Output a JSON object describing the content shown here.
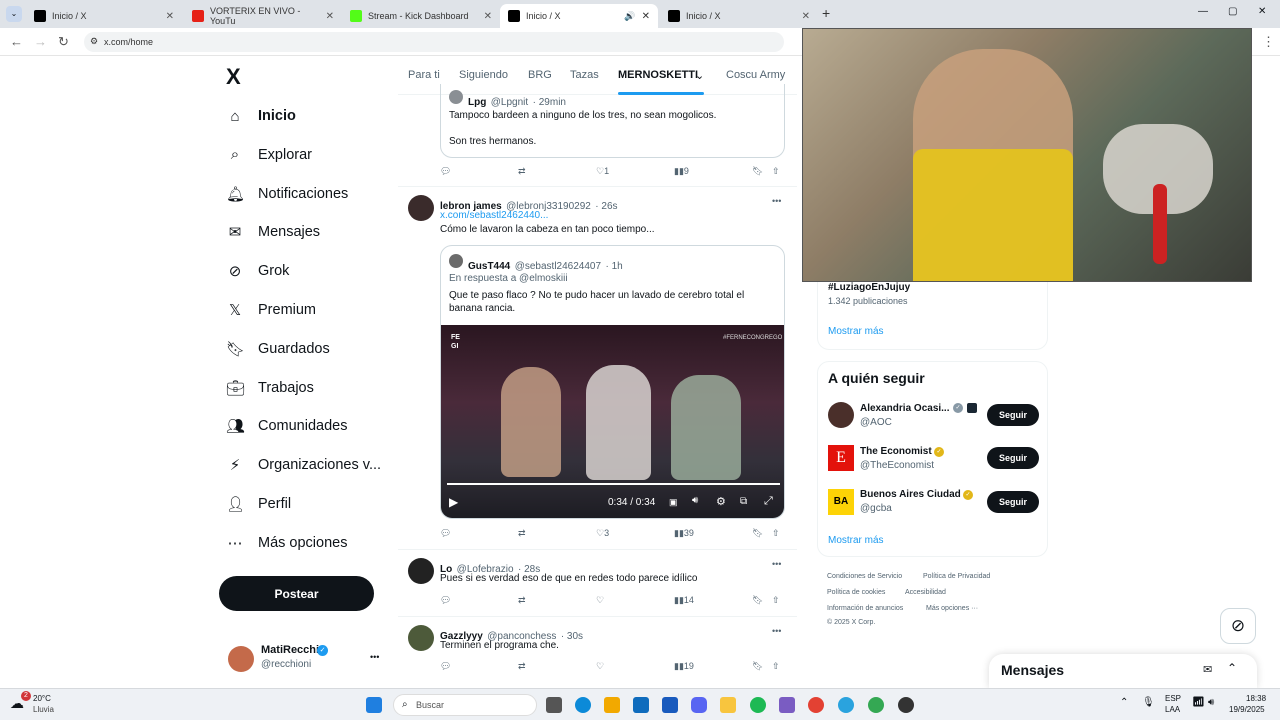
{
  "browser": {
    "tabs": [
      {
        "title": "Inicio / X"
      },
      {
        "title": "VORTERIX EN VIVO - YouTu"
      },
      {
        "title": "Stream - Kick Dashboard"
      },
      {
        "title": "Inicio / X"
      },
      {
        "title": "Inicio / X"
      }
    ],
    "new_tab": "+",
    "url": "x.com/home"
  },
  "sidebar": {
    "logo": "X",
    "items": [
      {
        "label": "Inicio",
        "icon": "home-icon"
      },
      {
        "label": "Explorar",
        "icon": "search-icon"
      },
      {
        "label": "Notificaciones",
        "icon": "bell-icon"
      },
      {
        "label": "Mensajes",
        "icon": "mail-icon"
      },
      {
        "label": "Grok",
        "icon": "grok-icon"
      },
      {
        "label": "Premium",
        "icon": "x-icon"
      },
      {
        "label": "Guardados",
        "icon": "bookmark-icon"
      },
      {
        "label": "Trabajos",
        "icon": "briefcase-icon"
      },
      {
        "label": "Comunidades",
        "icon": "people-icon"
      },
      {
        "label": "Organizaciones v...",
        "icon": "lightning-icon"
      },
      {
        "label": "Perfil",
        "icon": "person-icon"
      },
      {
        "label": "Más opciones",
        "icon": "more-circle-icon"
      }
    ],
    "post_button": "Postear",
    "account": {
      "name": "MatiRecchi",
      "handle": "@recchioni",
      "more": "•••"
    }
  },
  "topnav": {
    "tabs": [
      "Para ti",
      "Siguiendo",
      "BRG",
      "Tazas",
      "MERNOSKETTI",
      "Coscu Army"
    ],
    "selected": "MERNOSKETTI"
  },
  "feed": {
    "quote_top": {
      "name": "Lpg",
      "handle": "@Lpgnit",
      "time": "· 29min",
      "text1": "Tampoco bardeen a ninguno de los tres, no sean mogolicos.",
      "text2": "Son tres hermanos."
    },
    "actions1": {
      "likes": "1",
      "views": "9"
    },
    "post1": {
      "name": "lebron james",
      "handle": "@lebronj33190292",
      "time": "· 26s",
      "link": "x.com/sebastl2462440...",
      "text": "Cómo le lavaron la cabeza en tan poco tiempo...",
      "quote": {
        "name": "GusT444",
        "handle": "@sebastl24624407",
        "time": "· 1h",
        "reply_to": "En respuesta a @elmoskiii",
        "text": "Que te paso flaco ? No te pudo hacer un lavado de cerebro total el banana rancia.",
        "video_time": "0:34 / 0:34",
        "video_tag": "#FERNECONGREGO",
        "video_logo": "FE GI"
      }
    },
    "actions2": {
      "likes": "3",
      "views": "39"
    },
    "post2": {
      "name": "Lo",
      "handle": "@Lofebrazio",
      "time": "· 28s",
      "text": "Pues si es verdad eso de que en redes todo parece idílico"
    },
    "actions3": {
      "views": "14"
    },
    "post3": {
      "name": "Gazzlyyy",
      "handle": "@panconchess",
      "time": "· 30s",
      "text": "Terminen el programa che."
    },
    "actions4": {
      "views": "19"
    },
    "more_menu": "•••"
  },
  "right": {
    "trend": {
      "tag": "#LuziagoEnJujuy",
      "count": "1.342 publicaciones",
      "more": "Mostrar más"
    },
    "follow": {
      "title": "A quién seguir",
      "items": [
        {
          "name": "Alexandria Ocasi...",
          "handle": "@AOC",
          "button": "Seguir"
        },
        {
          "name": "The Economist",
          "handle": "@TheEconomist",
          "button": "Seguir"
        },
        {
          "name": "Buenos Aires Ciudad",
          "handle": "@gcba",
          "button": "Seguir"
        }
      ],
      "more": "Mostrar más"
    },
    "footer": {
      "l1a": "Condiciones de Servicio",
      "l1b": "Política de Privacidad",
      "l2a": "Política de cookies",
      "l2b": "Accesibilidad",
      "l3a": "Información de anuncios",
      "l3b": "Más opciones ···",
      "copy": "© 2025 X Corp."
    },
    "messages": "Mensajes"
  },
  "taskbar": {
    "weather_temp": "20°C",
    "weather_desc": "Lluvia",
    "weather_badge": "2",
    "search": "Buscar",
    "lang1": "ESP",
    "lang2": "LAA",
    "time": "18:38",
    "date": "19/9/2025"
  },
  "colors": {
    "accent": "#1d9bf0",
    "dark": "#0f1419",
    "muted": "#536471"
  }
}
